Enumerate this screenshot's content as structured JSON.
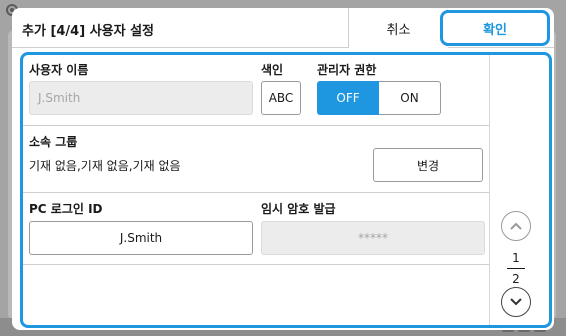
{
  "dialog": {
    "title": "추가 [4/4] 사용자 설정",
    "cancel_label": "취소",
    "ok_label": "확인"
  },
  "user_name": {
    "label": "사용자 이름",
    "value": "J.Smith"
  },
  "index": {
    "label": "색인",
    "button_label": "ABC"
  },
  "admin": {
    "label": "관리자 권한",
    "off_label": "OFF",
    "on_label": "ON",
    "selected": "OFF"
  },
  "group": {
    "label": "소속 그룹",
    "value": "기재 없음,기재 없음,기재 없음",
    "change_label": "변경"
  },
  "pc_login": {
    "label": "PC 로그인 ID",
    "value": "J.Smith"
  },
  "temp_password": {
    "label": "임시 암호 발급",
    "value": "*****"
  },
  "pager": {
    "current": "1",
    "total": "2"
  },
  "colors": {
    "accent": "#1f97e0",
    "disabled_text": "#a6a6a6",
    "disabled_bg": "#ececec"
  },
  "icons": [
    "gear-icon",
    "chevron-up-icon",
    "chevron-down-icon"
  ]
}
